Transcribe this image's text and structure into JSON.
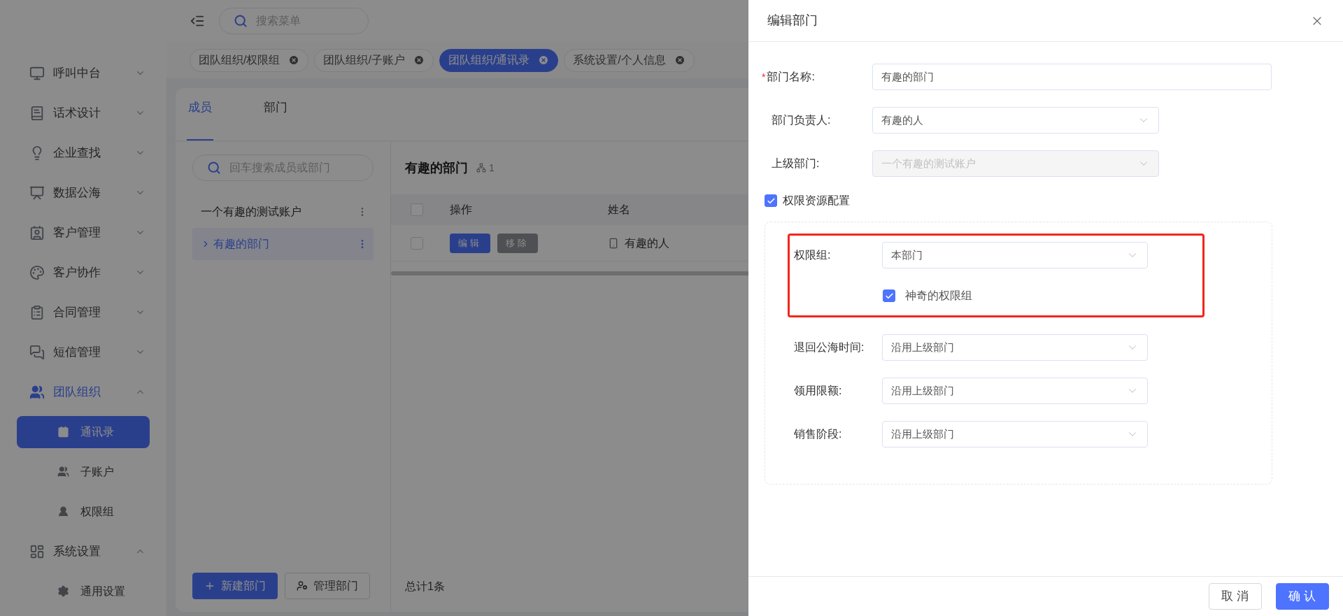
{
  "sidebar": {
    "items": [
      {
        "label": "呼叫中台",
        "expanded": false,
        "selected": false
      },
      {
        "label": "话术设计",
        "expanded": false,
        "selected": false
      },
      {
        "label": "企业查找",
        "expanded": false,
        "selected": false
      },
      {
        "label": "数据公海",
        "expanded": false,
        "selected": false
      },
      {
        "label": "客户管理",
        "expanded": false,
        "selected": false
      },
      {
        "label": "客户协作",
        "expanded": false,
        "selected": false
      },
      {
        "label": "合同管理",
        "expanded": false,
        "selected": false
      },
      {
        "label": "短信管理",
        "expanded": false,
        "selected": false
      },
      {
        "label": "团队组织",
        "expanded": true,
        "selected": true,
        "children": [
          {
            "label": "通讯录",
            "selected": true
          },
          {
            "label": "子账户",
            "selected": false
          },
          {
            "label": "权限组",
            "selected": false
          }
        ]
      },
      {
        "label": "系统设置",
        "expanded": true,
        "selected": false,
        "children": [
          {
            "label": "通用设置",
            "selected": false
          }
        ]
      }
    ]
  },
  "top_bar": {
    "search": {
      "placeholder": "搜索菜单"
    }
  },
  "open_tabs": [
    {
      "label": "团队组织/权限组",
      "selected": false
    },
    {
      "label": "团队组织/子账户",
      "selected": false
    },
    {
      "label": "团队组织/通讯录",
      "selected": true
    },
    {
      "label": "系统设置/个人信息",
      "selected": false
    }
  ],
  "content": {
    "tabs": [
      {
        "label": "成员",
        "selected": true
      },
      {
        "label": "部门",
        "selected": false
      }
    ],
    "tree_search": {
      "placeholder": "回车搜索成员或部门"
    },
    "tree": [
      {
        "label": "一个有趣的测试账户",
        "selected": false,
        "children": [
          {
            "label": "有趣的部门",
            "selected": true,
            "expanded": false
          }
        ]
      }
    ],
    "tree_buttons": [
      {
        "label": "新建部门",
        "kind": "primary"
      },
      {
        "label": "管理部门",
        "kind": "default"
      }
    ],
    "department": {
      "title": "有趣的部门",
      "member_count": "1"
    },
    "table": {
      "all_checked": false,
      "columns": [
        "操作",
        "姓名"
      ],
      "rows": [
        {
          "checked": false,
          "actions": [
            {
              "label": "编辑",
              "kind": "primary"
            },
            {
              "label": "移除",
              "kind": "muted"
            }
          ],
          "name": "有趣的人"
        }
      ]
    },
    "total": "总计1条"
  },
  "drawer": {
    "title": "编辑部门",
    "fields": [
      {
        "label": "部门名称:",
        "required_mark": "*",
        "kind": "input",
        "value": "有趣的部门",
        "disabled": false
      },
      {
        "label": "部门负责人:",
        "kind": "select",
        "value": "有趣的人",
        "disabled": false
      },
      {
        "label": "上级部门:",
        "kind": "select",
        "value": "一个有趣的测试账户",
        "disabled": true
      }
    ],
    "permission_config": {
      "label": "权限资源配置",
      "checked": true
    },
    "highlighted_fields": [
      {
        "kind": "select",
        "label": "权限组:",
        "value": "本部门"
      },
      {
        "kind": "checkbox",
        "label": "神奇的权限组",
        "checked": true
      }
    ],
    "sub_fields": [
      {
        "kind": "select",
        "label": "退回公海时间:",
        "value": "沿用上级部门"
      },
      {
        "kind": "select",
        "label": "领用限额:",
        "value": "沿用上级部门"
      },
      {
        "kind": "select",
        "label": "销售阶段:",
        "value": "沿用上级部门"
      }
    ],
    "buttons": [
      {
        "label": "取消",
        "kind": "default"
      },
      {
        "label": "确认",
        "kind": "primary"
      }
    ]
  }
}
